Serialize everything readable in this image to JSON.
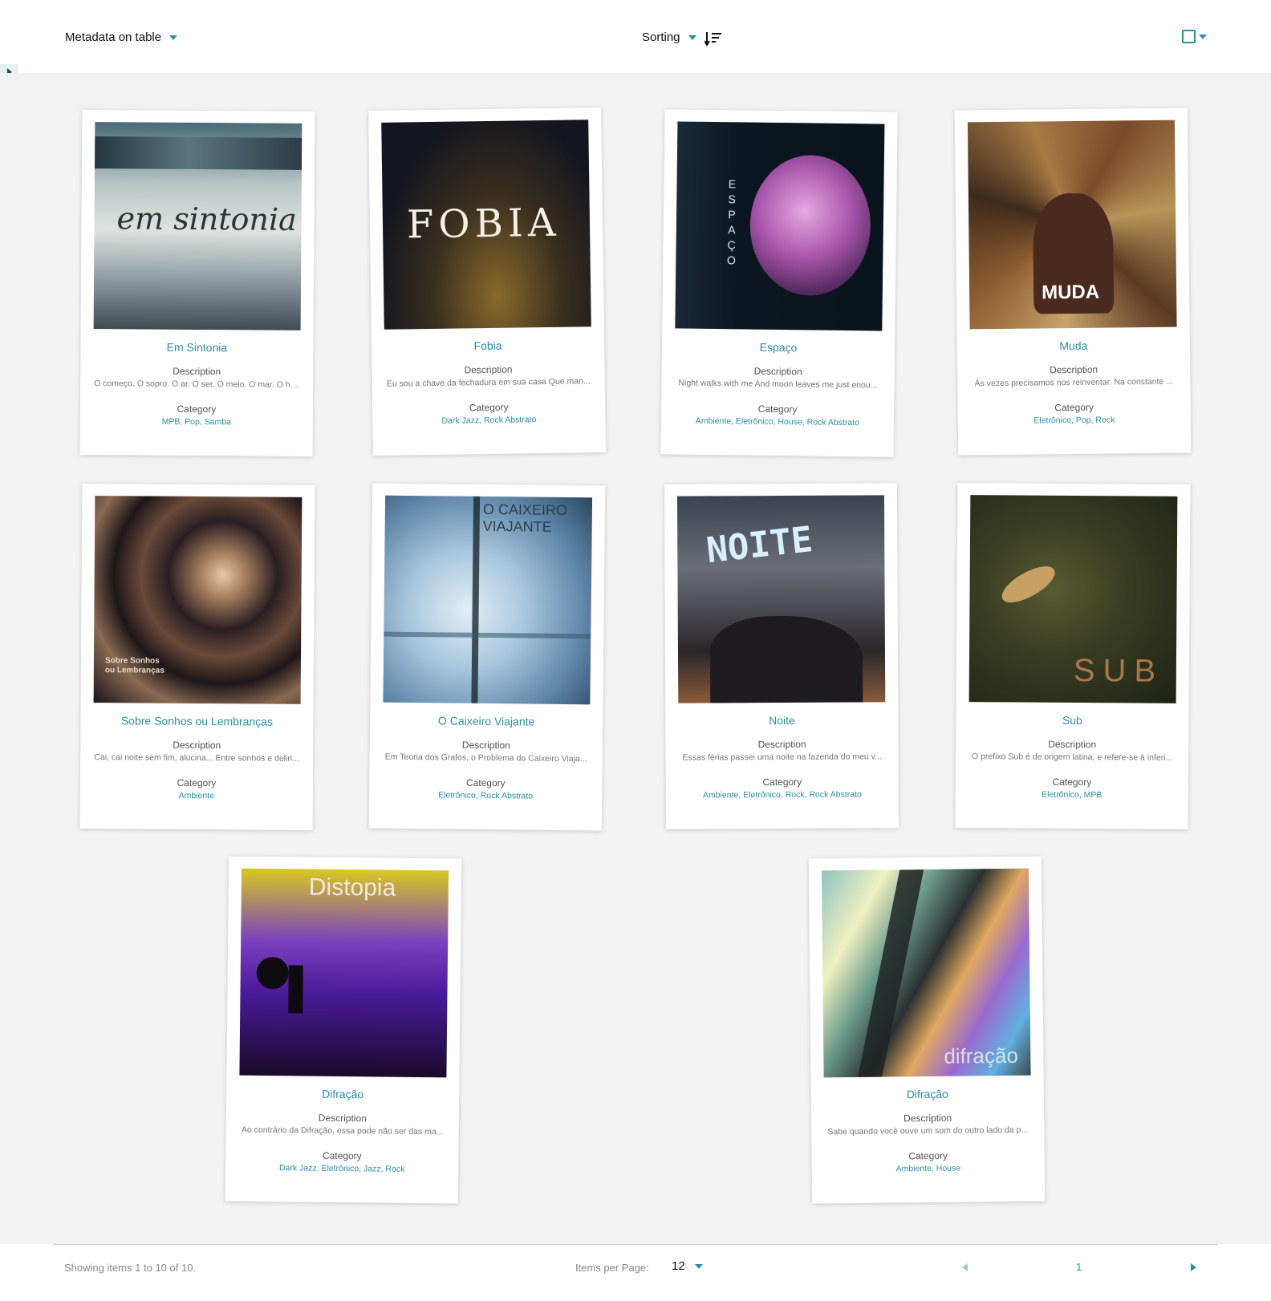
{
  "toolbar": {
    "metadata_label": "Metadata on table",
    "sorting_label": "Sorting",
    "sort_icon": "sort-descending-icon",
    "view_icon": "card-view-icon"
  },
  "items": [
    {
      "title": "Em Sintonia",
      "cover_text": "em sintonia",
      "description_label": "Description",
      "description": "O começo. O sopro. O ar. O ser. O meio. O mar. O ho...",
      "category_label": "Category",
      "categories": "MPB, Pop, Samba"
    },
    {
      "title": "Fobia",
      "cover_text": "FOBIA",
      "description_label": "Description",
      "description": "Eu sou a chave da fechadura em sua casa Que man...",
      "category_label": "Category",
      "categories": "Dark Jazz, Rock Abstrato"
    },
    {
      "title": "Espaço",
      "cover_text": "ESPAÇO",
      "description_label": "Description",
      "description": "Night walks with me And moon leaves me just enou...",
      "category_label": "Category",
      "categories": "Ambiente, Eletrônico, House, Rock Abstrato"
    },
    {
      "title": "Muda",
      "cover_text": "MUDA",
      "description_label": "Description",
      "description": "Às vezes precisamos nos reinventar. Na constante ...",
      "category_label": "Category",
      "categories": "Eletrônico, Pop, Rock"
    },
    {
      "title": "Sobre Sonhos ou Lembranças",
      "cover_text": "Sobre Sonhos ou Lembranças",
      "description_label": "Description",
      "description": "Cai, cai noite sem fim, alucina... Entre sonhos e deliri...",
      "category_label": "Category",
      "categories": "Ambiente"
    },
    {
      "title": "O Caixeiro Viajante",
      "cover_text": "O CAIXEIRO VIAJANTE",
      "description_label": "Description",
      "description": "Em Teoria dos Grafos, o Problema do Caixeiro Viaja...",
      "category_label": "Category",
      "categories": "Eletrônico, Rock Abstrato"
    },
    {
      "title": "Noite",
      "cover_text": "NOITE",
      "description_label": "Description",
      "description": "Essas férias passei uma noite na fazenda do meu v...",
      "category_label": "Category",
      "categories": "Ambiente, Eletrônico, Rock, Rock Abstrato"
    },
    {
      "title": "Sub",
      "cover_text": "SUB",
      "description_label": "Description",
      "description": "O prefixo Sub é de origem latina, e refere-se à inferi...",
      "category_label": "Category",
      "categories": "Eletrônico, MPB"
    },
    {
      "title": "Difração",
      "cover_text": "Distopia",
      "description_label": "Description",
      "description": "Ao contrário da Difração, essa pode não ser das ma...",
      "category_label": "Category",
      "categories": "Dark Jazz, Eletrônico, Jazz, Rock"
    },
    {
      "title": "Difração",
      "cover_text": "difração",
      "description_label": "Description",
      "description": "Sabe quando você ouve um som do outro lado da p...",
      "category_label": "Category",
      "categories": "Ambiente, House"
    }
  ],
  "footer": {
    "showing": "Showing items 1 to 10 of 10.",
    "items_per_page_label": "Items per Page:",
    "items_per_page_value": "12",
    "current_page": "1"
  }
}
